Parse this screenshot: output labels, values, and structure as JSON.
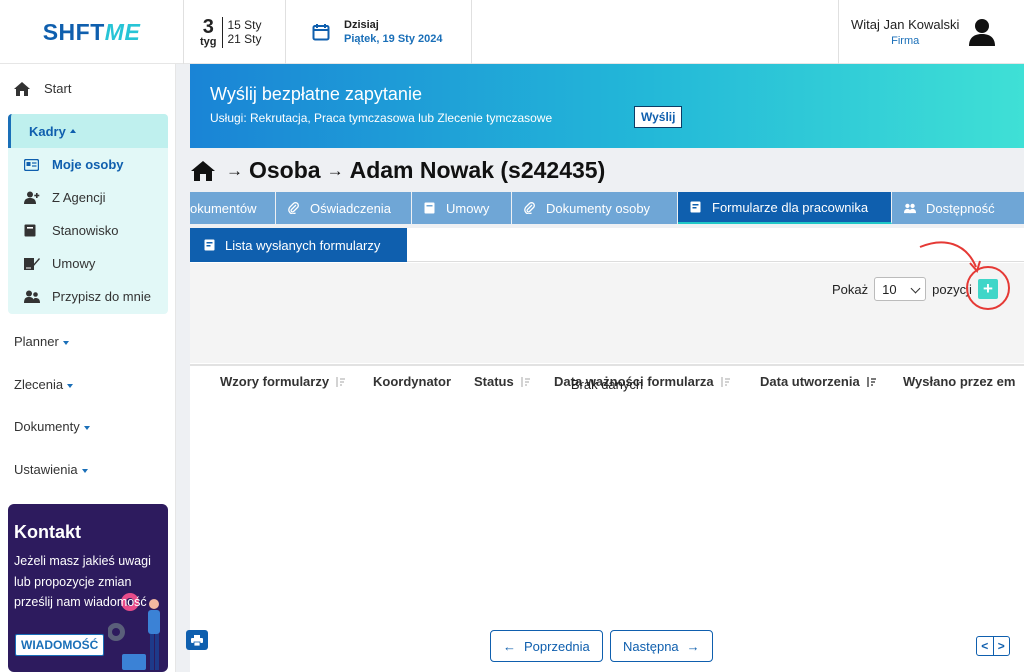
{
  "brand": {
    "part1": "SHFT",
    "part2": "ME"
  },
  "week": {
    "number": "3",
    "abbr": "tyg",
    "start": "15 Sty",
    "end": "21 Sty"
  },
  "today": {
    "label": "Dzisiaj",
    "date": "Piątek, 19 Sty 2024"
  },
  "user": {
    "greeting": "Witaj Jan Kowalski",
    "company": "Firma",
    "icon": "user-avatar-icon"
  },
  "sidebar": {
    "start": "Start",
    "kadry": {
      "label": "Kadry",
      "items": [
        {
          "label": "Moje osoby",
          "icon": "id-card-icon"
        },
        {
          "label": "Z Agencji",
          "icon": "user-plus-icon"
        },
        {
          "label": "Stanowisko",
          "icon": "book-icon"
        },
        {
          "label": "Umowy",
          "icon": "signature-icon"
        },
        {
          "label": "Przypisz do mnie",
          "icon": "users-icon"
        }
      ]
    },
    "menus": [
      "Planner",
      "Zlecenia",
      "Dokumenty",
      "Ustawienia"
    ],
    "contact": {
      "title": "Kontakt",
      "text": "Jeżeli masz jakieś uwagi lub propozycje zmian prześlij nam wiadomość",
      "button": "WIADOMOŚĆ"
    }
  },
  "banner": {
    "title": "Wyślij bezpłatne zapytanie",
    "subtitle": "Usługi: Rekrutacja, Praca tymczasowa lub Zlecenie tymczasowe",
    "button": "Wyślij"
  },
  "breadcrumb": {
    "part1": "Osoba",
    "part2": "Adam Nowak (s242435)"
  },
  "tabs": [
    {
      "label": "okumentów",
      "icon": ""
    },
    {
      "label": "Oświadczenia",
      "icon": "paperclip-icon"
    },
    {
      "label": "Umowy",
      "icon": "book-icon"
    },
    {
      "label": "Dokumenty osoby",
      "icon": "paperclip-icon"
    },
    {
      "label": "Formularze dla pracownika",
      "icon": "form-icon",
      "active": true
    },
    {
      "label": "Dostępność",
      "icon": "users-icon"
    }
  ],
  "subtab": {
    "label": "Lista wysłanych formularzy"
  },
  "controls": {
    "show_label": "Pokaż",
    "page_size": "10",
    "after_label": "pozycji",
    "add": "+"
  },
  "table": {
    "columns": [
      "Wzory formularzy",
      "Koordynator",
      "Status",
      "Data ważności formularza",
      "Data utworzenia",
      "Wysłano przez em"
    ],
    "empty": "Brak danych"
  },
  "pagination": {
    "prev": "Poprzednia",
    "next": "Następna",
    "left": "<",
    "right": ">"
  },
  "colors": {
    "primary": "#0f5fae",
    "teal": "#3fd6c8",
    "tab": "#6fa6d6",
    "sidebar_active": "#e2f8f7",
    "highlight": "#e53935"
  }
}
